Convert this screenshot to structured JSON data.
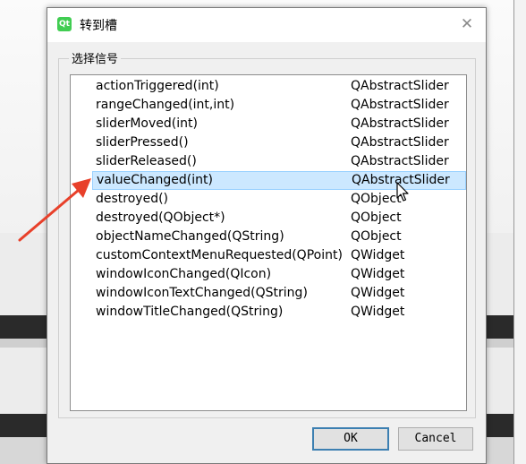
{
  "dialog": {
    "title": "转到槽",
    "app_icon_text": "Qt",
    "close_symbol": "✕",
    "group_label": "选择信号",
    "signals": [
      {
        "signal": "actionTriggered(int)",
        "class": "QAbstractSlider",
        "selected": false
      },
      {
        "signal": "rangeChanged(int,int)",
        "class": "QAbstractSlider",
        "selected": false
      },
      {
        "signal": "sliderMoved(int)",
        "class": "QAbstractSlider",
        "selected": false
      },
      {
        "signal": "sliderPressed()",
        "class": "QAbstractSlider",
        "selected": false
      },
      {
        "signal": "sliderReleased()",
        "class": "QAbstractSlider",
        "selected": false
      },
      {
        "signal": "valueChanged(int)",
        "class": "QAbstractSlider",
        "selected": true
      },
      {
        "signal": "destroyed()",
        "class": "QObject",
        "selected": false
      },
      {
        "signal": "destroyed(QObject*)",
        "class": "QObject",
        "selected": false
      },
      {
        "signal": "objectNameChanged(QString)",
        "class": "QObject",
        "selected": false
      },
      {
        "signal": "customContextMenuRequested(QPoint)",
        "class": "QWidget",
        "selected": false
      },
      {
        "signal": "windowIconChanged(QIcon)",
        "class": "QWidget",
        "selected": false
      },
      {
        "signal": "windowIconTextChanged(QString)",
        "class": "QWidget",
        "selected": false
      },
      {
        "signal": "windowTitleChanged(QString)",
        "class": "QWidget",
        "selected": false
      }
    ],
    "ok_label": "OK",
    "cancel_label": "Cancel"
  },
  "colors": {
    "selection": "#cce8ff",
    "annotation_arrow": "#e8402a",
    "default_button_border": "#3c7fb1"
  }
}
